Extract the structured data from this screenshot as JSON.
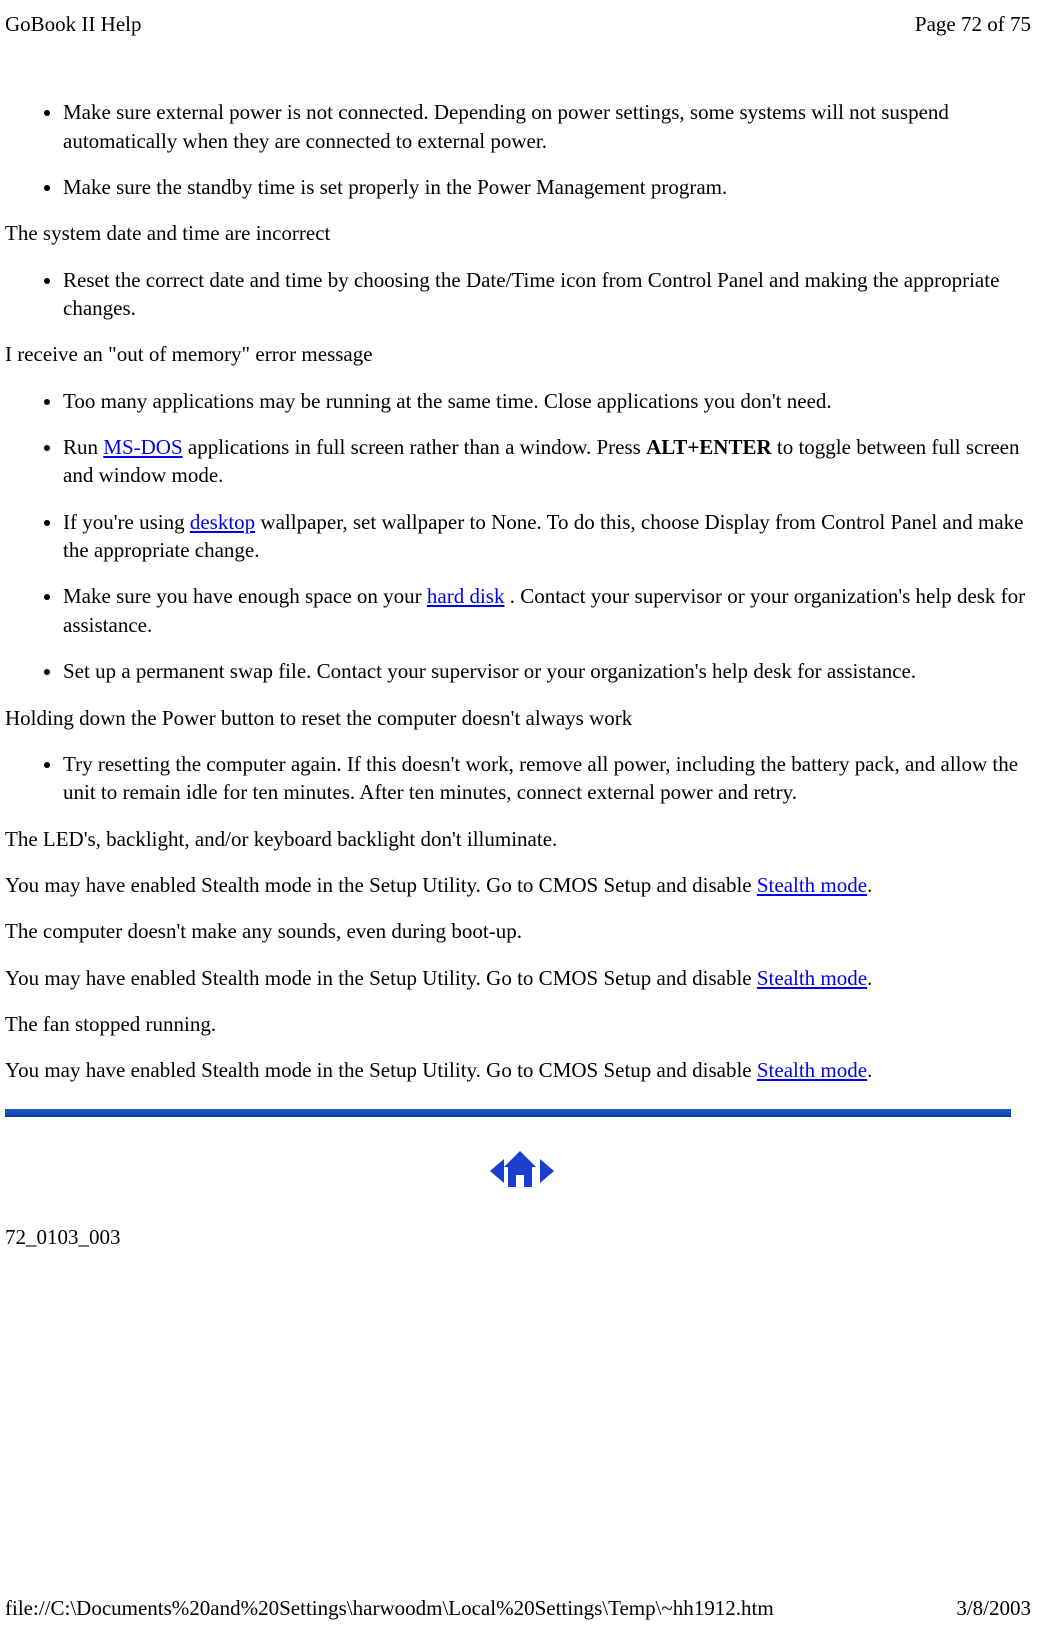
{
  "header": {
    "title": "GoBook II Help",
    "page_info": "Page 72 of 75"
  },
  "content": {
    "list1": {
      "item1": "Make sure external power is not connected. Depending on power settings, some systems will not suspend automatically when they are connected to external power.",
      "item2": "Make sure the standby time is set properly in the Power Management program."
    },
    "heading1": "The system date and time are incorrect",
    "list2": {
      "item1": "Reset the correct date and time by choosing the Date/Time icon from Control Panel and making the appropriate changes."
    },
    "heading2": "I receive an \"out of memory\" error message",
    "list3": {
      "item1": "Too many applications may be running at the same time. Close applications you don't need.",
      "item2_pre": "Run ",
      "item2_link": "MS-DOS",
      "item2_mid": " applications in full screen rather than a window. Press ",
      "item2_bold": "ALT+ENTER",
      "item2_post": " to toggle between full screen and window mode.",
      "item3_pre": "If you're using ",
      "item3_link": "desktop",
      "item3_post": " wallpaper, set wallpaper to None. To do this, choose Display from Control Panel and make the appropriate change.",
      "item4_pre": "Make sure you have enough space on your ",
      "item4_link": "hard disk",
      "item4_post": " . Contact your supervisor or your organization's help desk for assistance.",
      "item5": "Set up a permanent swap file. Contact your supervisor or your organization's help desk for assistance."
    },
    "heading3": "Holding down the Power button to reset the computer doesn't always work",
    "list4": {
      "item1": "Try resetting the computer again. If this doesn't work, remove all power, including the battery pack, and allow the unit to remain idle for ten minutes. After ten minutes, connect external power and retry."
    },
    "heading4": "The LED's, backlight, and/or keyboard backlight don't illuminate.",
    "para1_pre": "You may have enabled Stealth mode in the Setup Utility.  Go to CMOS Setup and disable ",
    "para1_link": "Stealth mode",
    "para1_post": ".",
    "heading5": "The computer doesn't make any sounds, even during boot-up.",
    "para2_pre": "You may have enabled  Stealth mode in the Setup Utility.  Go to CMOS Setup and disable ",
    "para2_link": "Stealth mode",
    "para2_post": ".",
    "heading6": "The fan stopped running.",
    "para3_pre": "You may have enabled Stealth mode in the Setup Utility.  Go to CMOS Setup and disable ",
    "para3_link": "Stealth mode",
    "para3_post": "."
  },
  "doc_id": "72_0103_003",
  "footer": {
    "path": "file://C:\\Documents%20and%20Settings\\harwoodm\\Local%20Settings\\Temp\\~hh1912.htm",
    "date": "3/8/2003"
  }
}
